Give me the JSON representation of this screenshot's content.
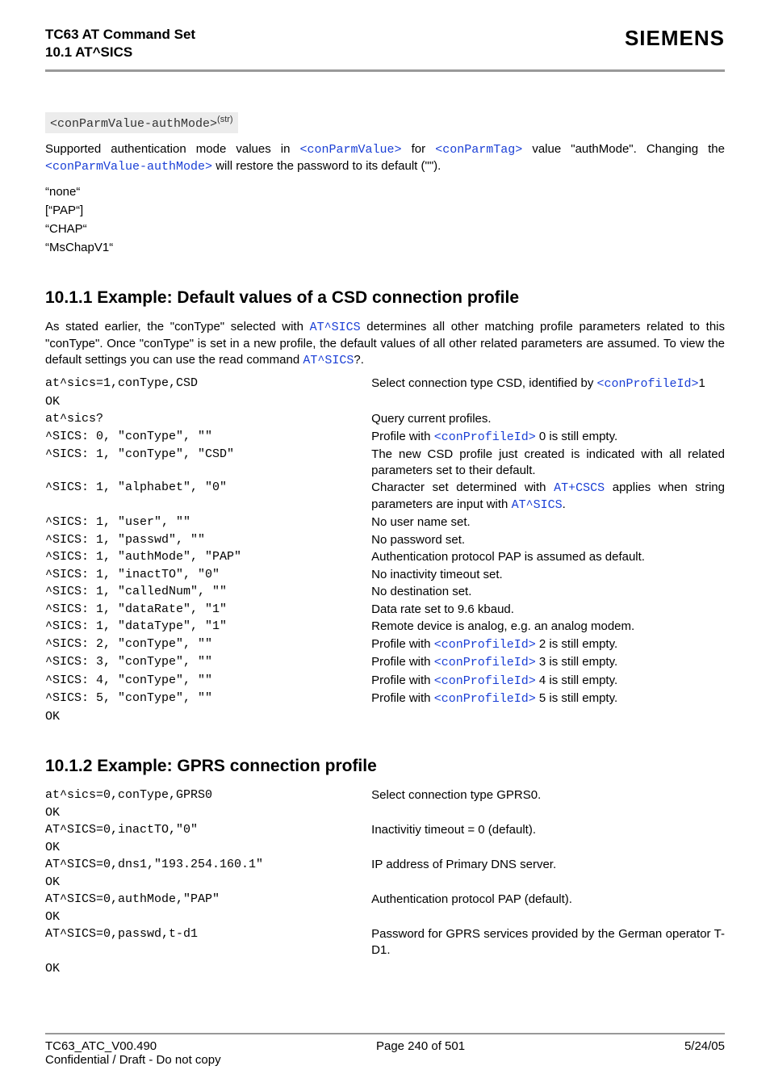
{
  "header": {
    "title_line1": "TC63 AT Command Set",
    "title_line2": "10.1 AT^SICS",
    "brand": "SIEMENS"
  },
  "param": {
    "name": "<conParmValue-authMode>",
    "sup": "(str)",
    "desc_pre": "Supported authentication mode values in ",
    "link1": "<conParmValue>",
    "desc_mid1": " for ",
    "link2": "<conParmTag>",
    "desc_mid2": " value \"authMode\". Changing the ",
    "link3": "<conParmValue-authMode>",
    "desc_post": " will restore the password to its default (\"\").",
    "values": [
      "“none“",
      "[“PAP“]",
      "“CHAP“",
      "“MsChapV1“"
    ]
  },
  "s1": {
    "title": "10.1.1    Example: Default values of a CSD connection profile",
    "intro_pre": "As stated earlier, the \"conType\" selected with ",
    "intro_l1": "AT^SICS",
    "intro_mid": " determines all other matching profile parameters related to this \"conType\". Once \"conType\" is set in a new profile, the default values of all other related parameters are assumed. To view the default settings you can use the read command ",
    "intro_l2": "AT^SICS",
    "intro_post": "?.",
    "rows": [
      {
        "l": "at^sics=1,conType,CSD",
        "r_pre": "Select connection type CSD, identified by ",
        "r_link": "<conProfileId>",
        "r_post": "1"
      },
      {
        "l": "OK",
        "r_pre": "",
        "r_link": "",
        "r_post": ""
      },
      {
        "l": "at^sics?",
        "r_pre": "Query current profiles.",
        "r_link": "",
        "r_post": ""
      },
      {
        "l": "^SICS: 0, \"conType\", \"\"",
        "r_pre": "Profile with ",
        "r_link": "<conProfileId>",
        "r_post": " 0 is still empty."
      },
      {
        "l": "^SICS: 1, \"conType\", \"CSD\"",
        "r_pre": "The new CSD profile just created is indicated with all related parameters set to their default.",
        "r_link": "",
        "r_post": ""
      },
      {
        "l": "^SICS: 1, \"alphabet\", \"0\"",
        "r_pre": "Character set determined with ",
        "r_link": "AT+CSCS",
        "r_post": " applies when string parameters are input with ",
        "r_link2": "AT^SICS",
        "r_post2": "."
      },
      {
        "l": "^SICS: 1, \"user\", \"\"",
        "r_pre": "No user name set.",
        "r_link": "",
        "r_post": ""
      },
      {
        "l": "^SICS: 1, \"passwd\", \"\"",
        "r_pre": "No password set.",
        "r_link": "",
        "r_post": ""
      },
      {
        "l": "^SICS: 1, \"authMode\", \"PAP\"",
        "r_pre": "Authentication protocol PAP is assumed as default.",
        "r_link": "",
        "r_post": ""
      },
      {
        "l": "^SICS: 1, \"inactTO\", \"0\"",
        "r_pre": "No inactivity timeout set.",
        "r_link": "",
        "r_post": ""
      },
      {
        "l": "^SICS: 1, \"calledNum\", \"\"",
        "r_pre": "No destination set.",
        "r_link": "",
        "r_post": ""
      },
      {
        "l": "^SICS: 1, \"dataRate\", \"1\"",
        "r_pre": "Data rate set to 9.6 kbaud.",
        "r_link": "",
        "r_post": ""
      },
      {
        "l": "^SICS: 1, \"dataType\", \"1\"",
        "r_pre": "Remote device is analog, e.g. an analog modem.",
        "r_link": "",
        "r_post": ""
      },
      {
        "l": "^SICS: 2, \"conType\", \"\"",
        "r_pre": "Profile with ",
        "r_link": "<conProfileId>",
        "r_post": " 2 is still empty."
      },
      {
        "l": "^SICS: 3, \"conType\", \"\"",
        "r_pre": "Profile with ",
        "r_link": "<conProfileId>",
        "r_post": " 3 is still empty."
      },
      {
        "l": "^SICS: 4, \"conType\", \"\"",
        "r_pre": "Profile with ",
        "r_link": "<conProfileId>",
        "r_post": " 4 is still empty."
      },
      {
        "l": "^SICS: 5, \"conType\", \"\"",
        "r_pre": "Profile with ",
        "r_link": "<conProfileId>",
        "r_post": " 5 is still empty."
      },
      {
        "l": "OK",
        "r_pre": "",
        "r_link": "",
        "r_post": ""
      }
    ]
  },
  "s2": {
    "title": "10.1.2    Example: GPRS connection profile",
    "rows": [
      {
        "l": "at^sics=0,conType,GPRS0",
        "r": "Select connection type GPRS0."
      },
      {
        "l": "OK",
        "r": ""
      },
      {
        "l": "AT^SICS=0,inactTO,\"0\"",
        "r": "Inactivitiy timeout = 0 (default)."
      },
      {
        "l": "OK",
        "r": ""
      },
      {
        "l": "AT^SICS=0,dns1,\"193.254.160.1\"",
        "r": "IP address of Primary DNS server."
      },
      {
        "l": "OK",
        "r": ""
      },
      {
        "l": "AT^SICS=0,authMode,\"PAP\"",
        "r": "Authentication protocol PAP (default)."
      },
      {
        "l": "OK",
        "r": ""
      },
      {
        "l": "AT^SICS=0,passwd,t-d1",
        "r": "Password for GPRS services provided by the German operator T-D1."
      },
      {
        "l": "",
        "r": ""
      },
      {
        "l": "OK",
        "r": ""
      }
    ]
  },
  "footer": {
    "left": "TC63_ATC_V00.490",
    "center": "Page 240 of 501",
    "right": "5/24/05",
    "bottom": "Confidential / Draft - Do not copy"
  }
}
